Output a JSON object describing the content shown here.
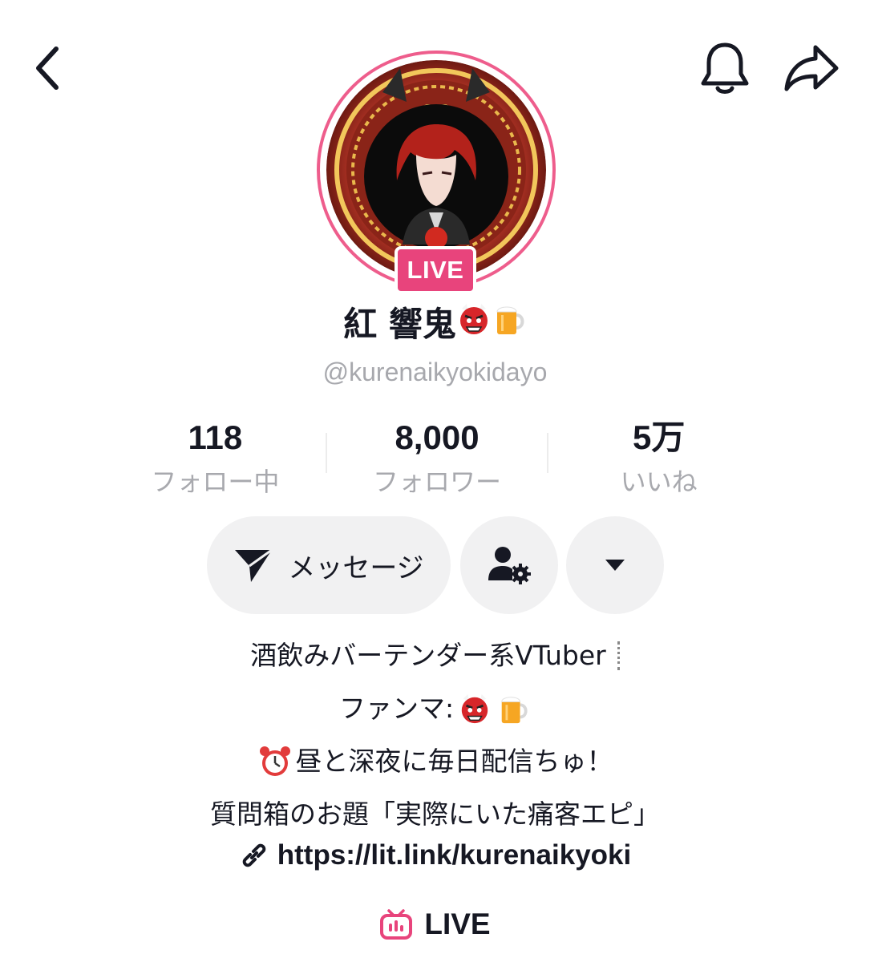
{
  "header": {
    "back_icon": "chevron-left-icon",
    "bell_icon": "bell-icon",
    "share_icon": "share-icon"
  },
  "profile": {
    "avatar_icon": "avatar",
    "live_badge": "LIVE",
    "display_name": "紅 響鬼",
    "name_emojis": [
      "red-oni-mask-emoji",
      "beer-mug-emoji"
    ],
    "handle": "@kurenaikyokidayo",
    "ring_color": "#ee5d8c",
    "live_color": "#e8447c"
  },
  "stats": [
    {
      "value": "118",
      "label": "フォロー中"
    },
    {
      "value": "8,000",
      "label": "フォロワー"
    },
    {
      "value": "5万",
      "label": "いいね"
    }
  ],
  "actions": {
    "message_label": "メッセージ",
    "message_icon": "send-icon",
    "friend_icon": "user-settings-icon",
    "more_icon": "caret-down-icon"
  },
  "bio": {
    "line1": "酒飲みバーテンダー系VTuber",
    "line2_prefix": "ファンマ:",
    "line3": "昼と深夜に毎日配信ちゅ！",
    "line4": "質問箱のお題「実際にいた痛客エピ」",
    "link": "https://lit.link/kurenaikyoki"
  },
  "tabs": {
    "live_label": "LIVE",
    "live_icon": "tv-live-icon"
  }
}
